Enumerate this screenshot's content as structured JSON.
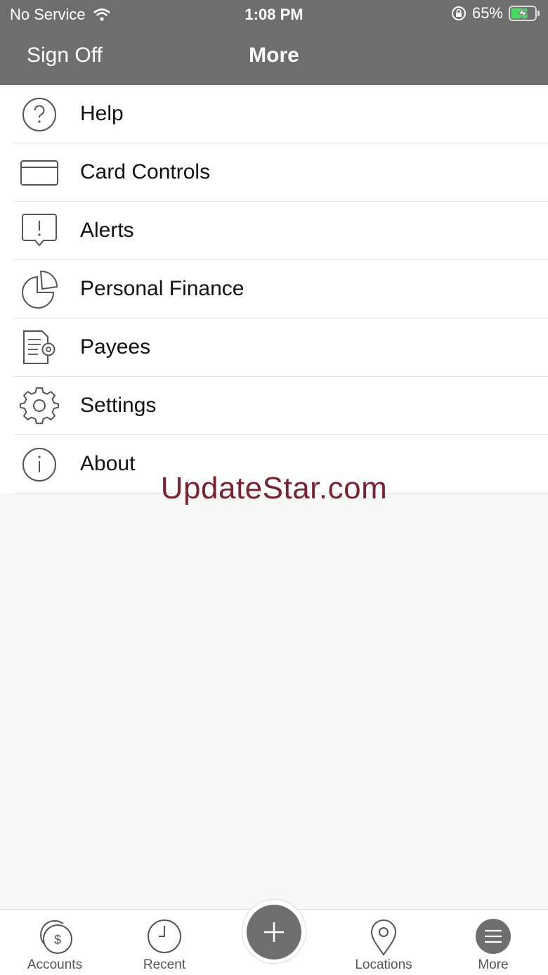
{
  "status": {
    "carrier": "No Service",
    "time": "1:08 PM",
    "battery": "65%"
  },
  "nav": {
    "left": "Sign Off",
    "title": "More"
  },
  "menu": [
    {
      "label": "Help",
      "icon": "help-icon"
    },
    {
      "label": "Card Controls",
      "icon": "credit-card-icon"
    },
    {
      "label": "Alerts",
      "icon": "alert-bubble-icon"
    },
    {
      "label": "Personal Finance",
      "icon": "pie-chart-icon"
    },
    {
      "label": "Payees",
      "icon": "payees-list-icon"
    },
    {
      "label": "Settings",
      "icon": "gear-icon"
    },
    {
      "label": "About",
      "icon": "info-icon"
    }
  ],
  "watermark": "UpdateStar.com",
  "tabs": [
    {
      "label": "Accounts",
      "icon": "accounts-icon"
    },
    {
      "label": "Recent",
      "icon": "clock-icon"
    },
    {
      "label": "",
      "icon": "plus-icon"
    },
    {
      "label": "Locations",
      "icon": "location-pin-icon"
    },
    {
      "label": "More",
      "icon": "menu-icon"
    }
  ],
  "colors": {
    "bar": "#6e6e6e",
    "watermark": "#7a2330",
    "battery": "#4cd964"
  }
}
